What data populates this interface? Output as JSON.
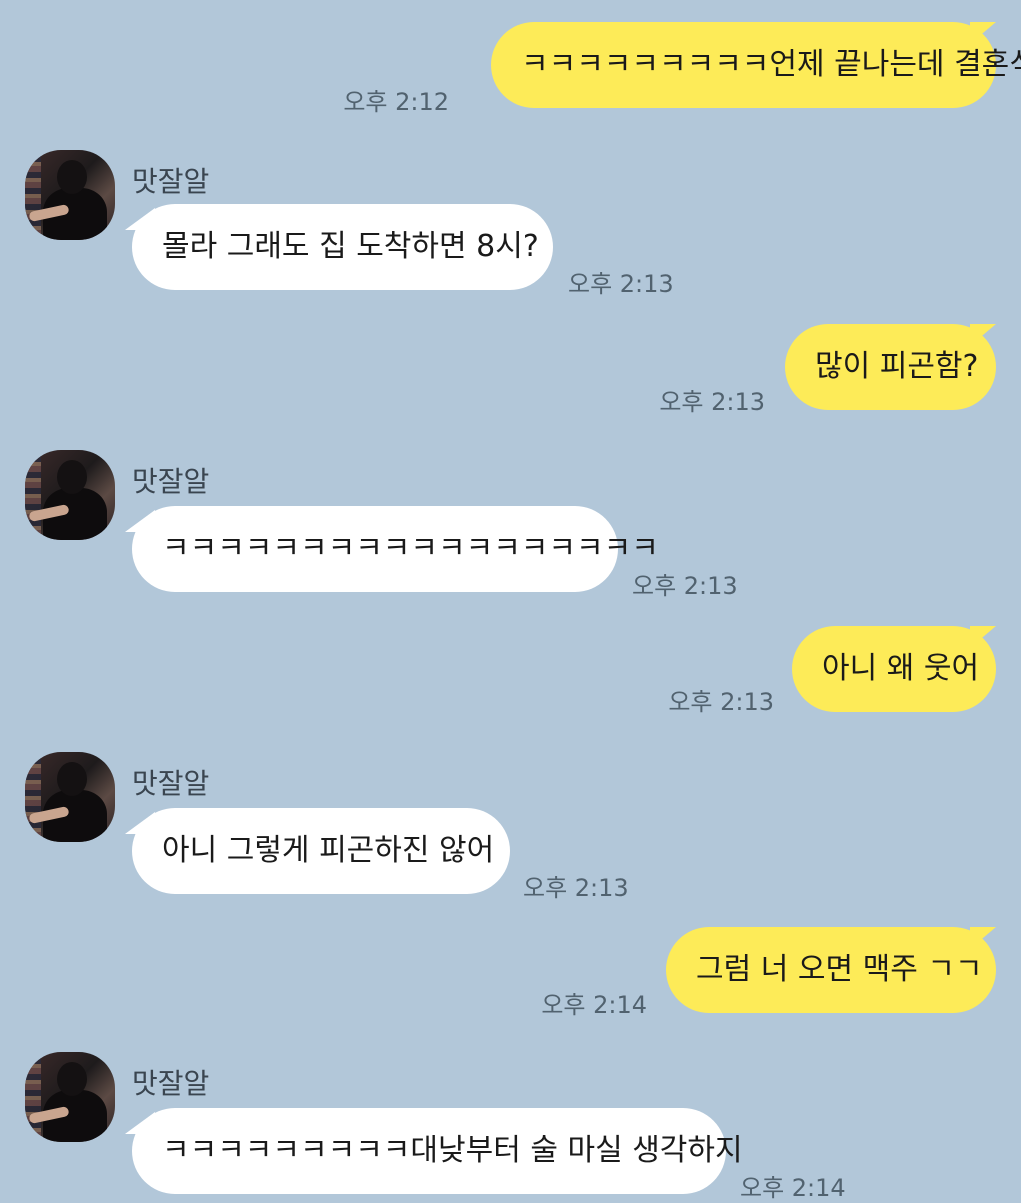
{
  "contact_name": "맛잘알",
  "messages": [
    {
      "sender": "me",
      "text": "ㅋㅋㅋㅋㅋㅋㅋㅋㅋ언제 끝나는데 결혼식",
      "time": "오후 2:12"
    },
    {
      "sender": "them",
      "name": "맛잘알",
      "text": "몰라 그래도 집 도착하면 8시?",
      "time": "오후 2:13"
    },
    {
      "sender": "me",
      "text": "많이 피곤함?",
      "time": "오후 2:13"
    },
    {
      "sender": "them",
      "name": "맛잘알",
      "text": "ㅋㅋㅋㅋㅋㅋㅋㅋㅋㅋㅋㅋㅋㅋㅋㅋㅋㅋ",
      "time": "오후 2:13"
    },
    {
      "sender": "me",
      "text": "아니 왜 웃어",
      "time": "오후 2:13"
    },
    {
      "sender": "them",
      "name": "맛잘알",
      "text": "아니 그렇게 피곤하진 않어",
      "time": "오후 2:13"
    },
    {
      "sender": "me",
      "text": "그럼 너 오면 맥주 ㄱㄱ",
      "time": "오후 2:14"
    },
    {
      "sender": "them",
      "name": "맛잘알",
      "text": "ㅋㅋㅋㅋㅋㅋㅋㅋㅋ대낮부터 술 마실 생각하지",
      "time": "오후 2:14"
    }
  ],
  "colors": {
    "background": "#b2c7d9",
    "my_bubble": "#fdeb58",
    "their_bubble": "#ffffff",
    "time_text": "#51626f"
  }
}
